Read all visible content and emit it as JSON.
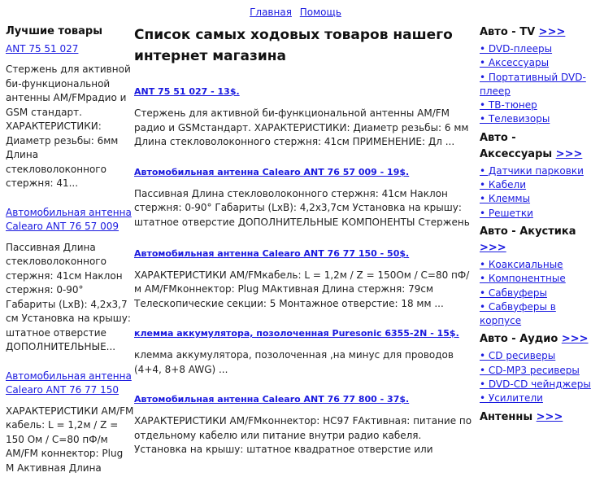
{
  "nav": {
    "home": "Главная",
    "help": "Помощь"
  },
  "left": {
    "title": "Лучшие товары",
    "items": [
      {
        "link": "ANT 75 51 027",
        "desc": "Стержень для активной би-функциональной антенны AM/FMрадио и GSM стандарт. ХАРАКТЕРИСТИКИ: Диаметр резьбы: 6мм Длина стекловолоконного стержня: 41..."
      },
      {
        "link": "Автомобильная антенна Calearo ANT 76 57 009",
        "desc": "Пассивная Длина стекловолоконного стержня: 41см Наклон стержня: 0-90° Габариты (LxB): 4,2x3,7 см Установка на крышу: штатное отверстие ДОПОЛНИТЕЛЬНЫЕ..."
      },
      {
        "link": "Автомобильная антенна Calearo ANT 76 77 150",
        "desc": "ХАРАКТЕРИСТИКИ AM/FM кабель: L = 1,2м / Z = 150 Ом / C=80 пФ/м AM/FM коннектор: Plug M Активная Длина"
      }
    ]
  },
  "main": {
    "title": "Список самых ходовых товаров нашего интернет магазина",
    "products": [
      {
        "link": "ANT 75 51 027 - 13$.",
        "desc": "Стержень для активной би-функциональной антенны AM/FM радио и GSMстандарт. ХАРАКТЕРИСТИКИ: Диаметр резьбы: 6 мм Длина стекловолоконного стержня: 41см ПРИМЕНЕНИЕ: Дл ..."
      },
      {
        "link": "Автомобильная антенна Calearo ANT 76 57 009 - 19$.",
        "desc": "Пассивная Длина стекловолоконного стержня: 41см Наклон стержня: 0-90° Габариты (LxB): 4,2x3,7см Установка на крышу: штатное отверстие ДОПОЛНИТЕЛЬНЫЕ КОМПОНЕНТЫ Стержень ..."
      },
      {
        "link": "Автомобильная антенна Calearo ANT 76 77 150 - 50$.",
        "desc": "ХАРАКТЕРИСТИКИ AM/FMкабель: L = 1,2м / Z = 150Ом / C=80 пФ/м AM/FMконнектор: Plug MАктивная Длина стержня: 79см Телескопические секции: 5 Монтажное отверстие: 18 мм ..."
      },
      {
        "link": "клемма аккумулятора, позолоченная Puresonic 6355-2N - 15$.",
        "desc": "клемма аккумулятора, позолоченная ,на минус для проводов (4+4, 8+8 AWG) ..."
      },
      {
        "link": "Автомобильная антенна Calearo ANT 76 77 800 - 37$.",
        "desc": "ХАРАКТЕРИСТИКИ AM/FMконнектор: HC97 FАктивная: питание по отдельному кабелю или питание внутри радио кабеля. Установка на крышу: штатное квадратное отверстие или"
      }
    ]
  },
  "right": {
    "more": ">>>",
    "categories": [
      {
        "title": "Авто - TV",
        "links": [
          "• DVD-плееры",
          "• Аксессуары",
          "• Портативный DVD-плеер",
          "• ТВ-тюнер",
          "• Телевизоры"
        ]
      },
      {
        "title": "Авто - Аксессуары",
        "links": [
          "• Датчики парковки",
          "• Кабели",
          "• Клеммы",
          "• Решетки"
        ]
      },
      {
        "title": "Авто - Акустика",
        "links": [
          "• Коаксиальные",
          "• Компонентные",
          "• Сабвуферы",
          "• Сабвуферы в корпусе"
        ]
      },
      {
        "title": "Авто - Аудио",
        "links": [
          "• CD ресиверы",
          "• CD-MP3 ресиверы",
          "• DVD-CD чейнджеры",
          "• Усилители"
        ]
      },
      {
        "title": "Антенны",
        "links": []
      }
    ]
  }
}
